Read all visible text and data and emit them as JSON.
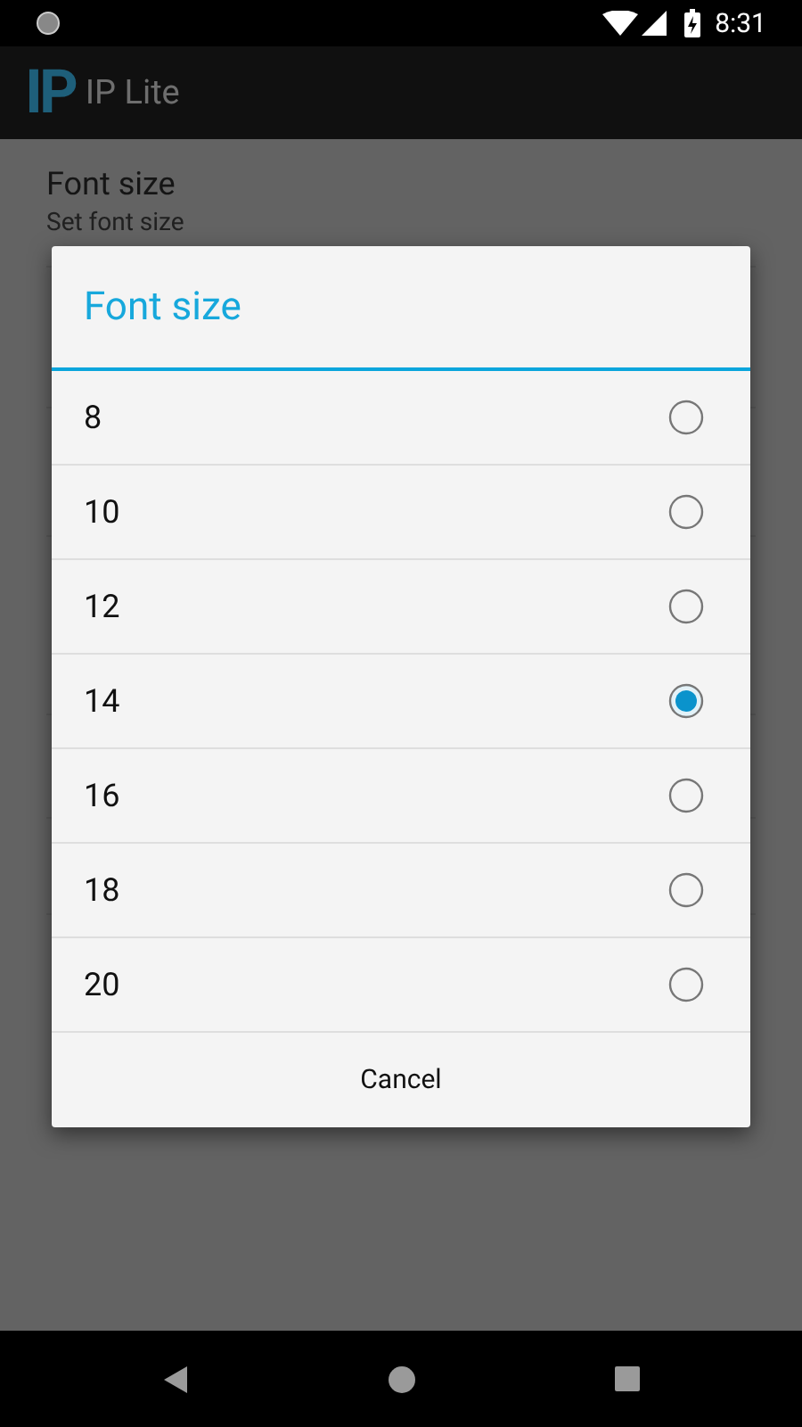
{
  "status_bar": {
    "time": "8:31"
  },
  "app_bar": {
    "logo": "IP",
    "title": "IP Lite"
  },
  "preference": {
    "title": "Font size",
    "summary": "Set font size"
  },
  "dialog": {
    "title": "Font size",
    "options": [
      {
        "label": "8",
        "selected": false
      },
      {
        "label": "10",
        "selected": false
      },
      {
        "label": "12",
        "selected": false
      },
      {
        "label": "14",
        "selected": true
      },
      {
        "label": "16",
        "selected": false
      },
      {
        "label": "18",
        "selected": false
      },
      {
        "label": "20",
        "selected": false
      }
    ],
    "buttons": [
      "Cancel"
    ]
  }
}
